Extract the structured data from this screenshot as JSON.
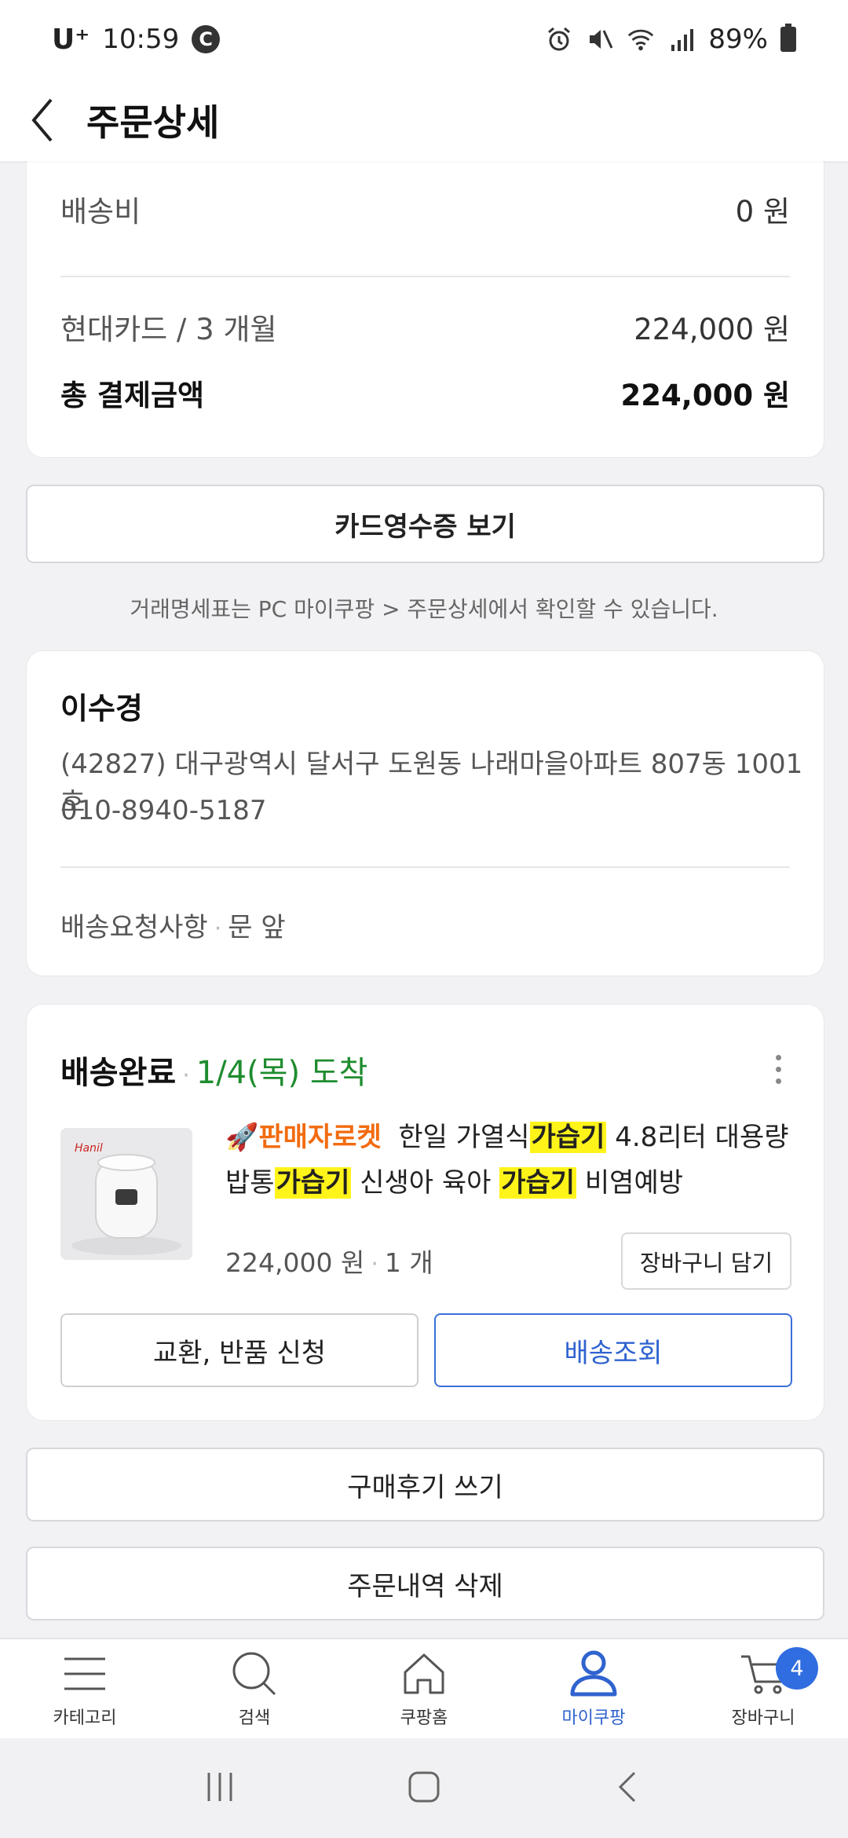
{
  "status_bar": {
    "carrier": "U⁺",
    "time": "10:59",
    "c_badge": "C",
    "battery": "89%"
  },
  "header": {
    "title": "주문상세"
  },
  "payment": {
    "shipping_label": "배송비",
    "shipping_value": "0 원",
    "card_label": "현대카드 / 3 개월",
    "card_value": "224,000 원",
    "total_label": "총 결제금액",
    "total_value": "224,000 원"
  },
  "receipt_button": "카드영수증 보기",
  "receipt_note": "거래명세표는 PC 마이쿠팡 > 주문상세에서 확인할 수 있습니다.",
  "recipient": {
    "name": "이수경",
    "address": "(42827) 대구광역시 달서구 도원동 나래마을아파트 807동 1001호",
    "phone": "010-8940-5187",
    "request_label": "배송요청사항",
    "request_value": "문 앞"
  },
  "delivery": {
    "status": "배송완료",
    "date": "1/4(목) 도착",
    "product": {
      "badge": "판매자로켓",
      "title_part1": "한일 가열식",
      "highlight1": "가습기",
      "title_part2": " 4.8리터 대용량 밥통",
      "highlight2": "가습기",
      "title_part3": " 신생아 육아 ",
      "highlight3": "가습기",
      "title_part4": " 비염예방",
      "price": "224,000 원",
      "quantity": "1 개"
    },
    "add_to_cart": "장바구니 담기",
    "exchange_return": "교환, 반품 신청",
    "track": "배송조회"
  },
  "review_button": "구매후기 쓰기",
  "delete_button": "주문내역 삭제",
  "bottom_nav": {
    "items": [
      {
        "label": "카테고리",
        "icon": "menu-icon"
      },
      {
        "label": "검색",
        "icon": "search-icon"
      },
      {
        "label": "쿠팡홈",
        "icon": "home-icon"
      },
      {
        "label": "마이쿠팡",
        "icon": "user-icon"
      },
      {
        "label": "장바구니",
        "icon": "cart-icon"
      }
    ],
    "cart_count": "4",
    "active": "마이쿠팡"
  },
  "colors": {
    "accent_blue": "#2f63cf",
    "delivered_green": "#1e8c2e",
    "rocket_orange": "#f26b0f",
    "highlight_yellow": "#fff41a"
  }
}
